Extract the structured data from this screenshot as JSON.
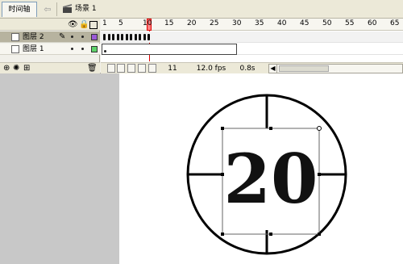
{
  "toolbar": {
    "timeline_tab": "时间轴",
    "scene_label": "场景 1"
  },
  "layers": [
    {
      "name": "图层 2",
      "selected": true,
      "color": "#9b59d6"
    },
    {
      "name": "图层 1",
      "selected": false,
      "color": "#5fd36b"
    }
  ],
  "ruler": {
    "labels": [
      "1",
      "5",
      "10",
      "15",
      "20",
      "25",
      "30",
      "35",
      "40",
      "45",
      "50",
      "55",
      "60",
      "65"
    ],
    "current_frame_label": "10"
  },
  "status": {
    "frame": "11",
    "fps": "12.0 fps",
    "time": "0.8s"
  },
  "stage": {
    "counter_text": "20"
  },
  "colors": {
    "ui_background": "#ece9d8",
    "pasteboard": "#c8c8c8",
    "stage": "#ffffff",
    "playhead": "#ff8080"
  },
  "icons": {
    "eye": "eye-icon",
    "lock": "lock-icon",
    "outline": "outline-square-icon",
    "pencil": "pencil-icon",
    "trash": "trash-icon"
  }
}
